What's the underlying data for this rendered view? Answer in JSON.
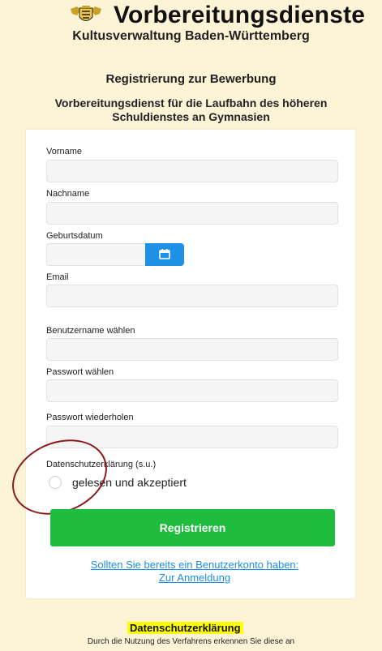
{
  "header": {
    "brand_title": "Vorbereitungsdienste",
    "brand_subtitle": "Kultusverwaltung Baden-Württemberg"
  },
  "registration": {
    "title": "Registrierung zur Bewerbung",
    "subtitle": "Vorbereitungsdienst für die Laufbahn des höheren Schuldienstes an Gymnasien"
  },
  "form": {
    "fields": [
      {
        "label": "Vorname",
        "value": ""
      },
      {
        "label": "Nachname",
        "value": ""
      },
      {
        "label": "Geburtsdatum",
        "value": ""
      },
      {
        "label": "Email",
        "value": ""
      },
      {
        "label": "Benutzername wählen",
        "value": ""
      },
      {
        "label": "Passwort wählen",
        "value": ""
      },
      {
        "label": "Passwort wiederholen",
        "value": ""
      }
    ],
    "privacy_label": "Datenschutzerklärung (s.u.)",
    "privacy_option": "gelesen und akzeptiert",
    "submit_label": "Registrieren",
    "login_link_line1": "Sollten Sie bereits ein Benutzerkonto haben:",
    "login_link_line2": "Zur Anmeldung"
  },
  "privacy": {
    "heading": "Datenschutzerklärung",
    "text": "Durch die Nutzung des Verfahrens erkennen Sie diese an"
  },
  "icons": {
    "coat_of_arms": "coat-of-arms-icon",
    "calendar": "calendar-icon"
  },
  "colors": {
    "background": "#fdf3d6",
    "accent_blue": "#1e90e6",
    "submit_green": "#1fbd3f",
    "link_blue": "#1a8fe3",
    "highlight_yellow": "#ffff00",
    "annotation_red": "#8b1a1a"
  }
}
